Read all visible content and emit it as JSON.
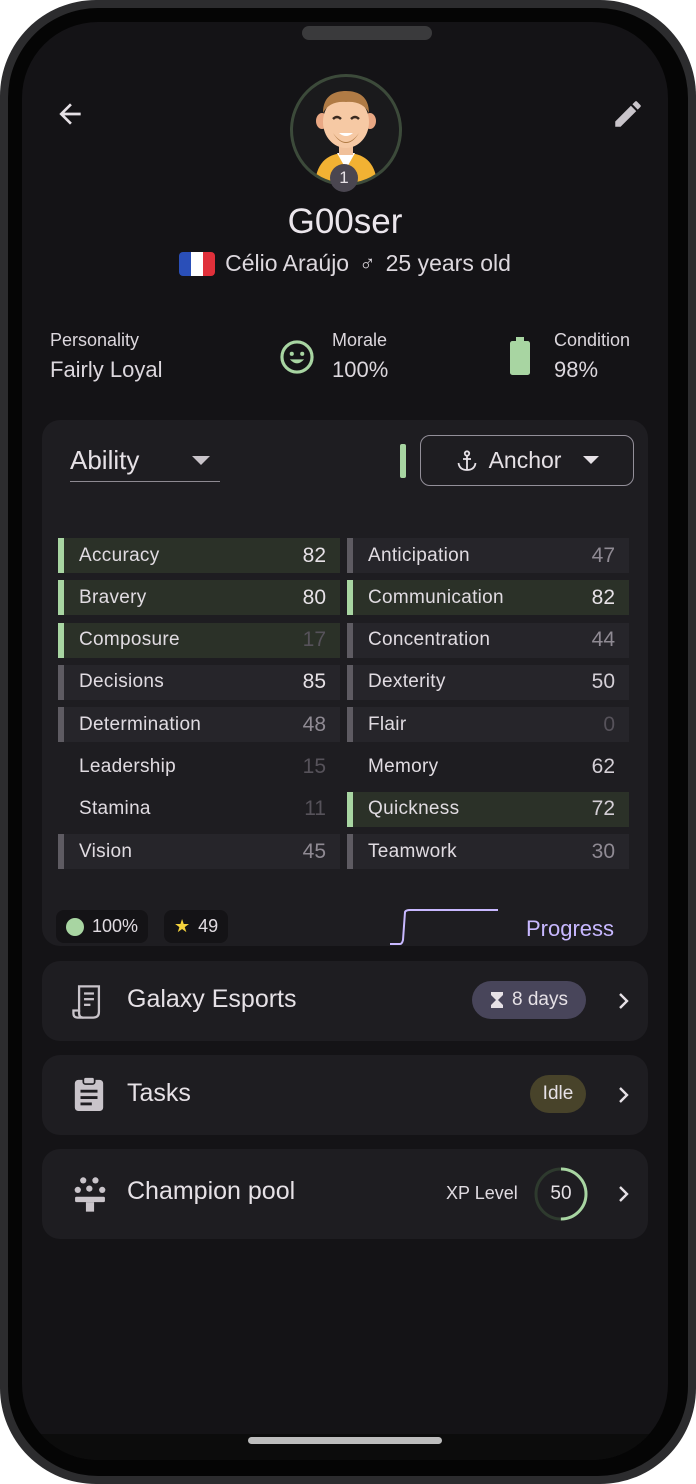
{
  "player": {
    "nickname": "G00ser",
    "rank": "1",
    "real_name": "Célio Araújo",
    "gender_symbol": "♂",
    "age": "25 years old",
    "nationality_flag": "france-flag"
  },
  "info": {
    "personality": {
      "label": "Personality",
      "value": "Fairly Loyal"
    },
    "morale": {
      "label": "Morale",
      "value": "100%",
      "icon": "happy-face-icon"
    },
    "condition": {
      "label": "Condition",
      "value": "98%",
      "icon": "battery-icon"
    }
  },
  "ability": {
    "select_label": "Ability",
    "role_label": "Anchor",
    "attributes_left": [
      {
        "name": "Accuracy",
        "value": "82",
        "tier": "high",
        "highlight": true
      },
      {
        "name": "Bravery",
        "value": "80",
        "tier": "high",
        "highlight": true
      },
      {
        "name": "Composure",
        "value": "17",
        "tier": "low",
        "highlight": true
      },
      {
        "name": "Decisions",
        "value": "85",
        "tier": "high",
        "highlight": false
      },
      {
        "name": "Determination",
        "value": "48",
        "tier": "mid",
        "highlight": false
      },
      {
        "name": "Leadership",
        "value": "15",
        "tier": "low",
        "highlight": null
      },
      {
        "name": "Stamina",
        "value": "11",
        "tier": "low",
        "highlight": null
      },
      {
        "name": "Vision",
        "value": "45",
        "tier": "mid",
        "highlight": false
      }
    ],
    "attributes_right": [
      {
        "name": "Anticipation",
        "value": "47",
        "tier": "mid",
        "highlight": false
      },
      {
        "name": "Communication",
        "value": "82",
        "tier": "high",
        "highlight": true
      },
      {
        "name": "Concentration",
        "value": "44",
        "tier": "mid",
        "highlight": false
      },
      {
        "name": "Dexterity",
        "value": "50",
        "tier": "high2",
        "highlight": false
      },
      {
        "name": "Flair",
        "value": "0",
        "tier": "low",
        "highlight": false
      },
      {
        "name": "Memory",
        "value": "62",
        "tier": "high2",
        "highlight": null
      },
      {
        "name": "Quickness",
        "value": "72",
        "tier": "high2",
        "highlight": true
      },
      {
        "name": "Teamwork",
        "value": "30",
        "tier": "mid",
        "highlight": false
      }
    ],
    "fitness_chip": "100%",
    "stars_chip": "49",
    "progress_label": "Progress"
  },
  "cards": {
    "team": {
      "title": "Galaxy Esports",
      "badge": "8 days",
      "icon": "contract-icon"
    },
    "tasks": {
      "title": "Tasks",
      "badge": "Idle",
      "icon": "clipboard-icon"
    },
    "champions": {
      "title": "Champion pool",
      "xp_label": "XP Level",
      "xp_value": "50",
      "xp_fraction": 0.5,
      "icon": "champion-pool-icon"
    }
  },
  "colors": {
    "accent_green": "#a8d5a2",
    "accent_purple": "#c8b8ff",
    "surface": "#1e1d21",
    "background": "#141316"
  }
}
